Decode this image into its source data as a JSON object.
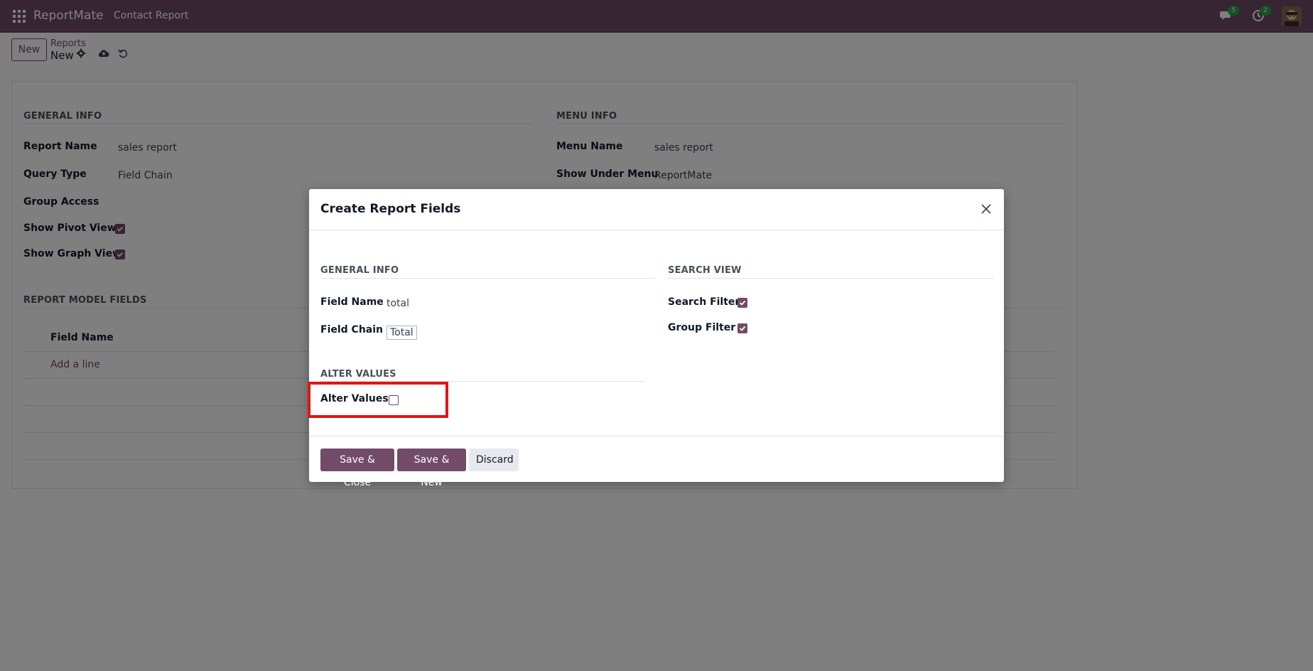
{
  "navbar": {
    "brand": "ReportMate",
    "menu_item": "Contact Report",
    "messages_badge": "5",
    "activities_badge": "2",
    "colors": {
      "bar": "#714b67",
      "badge": "#28a745"
    },
    "icons": [
      "apps-grid-icon",
      "chat-icon",
      "clock-icon",
      "avatar"
    ]
  },
  "control_panel": {
    "new_label": "New",
    "breadcrumb": "Reports",
    "record_title": "New",
    "icons": [
      "gear-icon",
      "cloud-upload-icon",
      "undo-icon"
    ]
  },
  "form": {
    "general_info": {
      "title": "GENERAL INFO",
      "report_name_label": "Report Name",
      "report_name_value": "sales report",
      "query_type_label": "Query Type",
      "query_type_value": "Field Chain",
      "group_access_label": "Group Access",
      "show_pivot_label": "Show Pivot View",
      "show_graph_label": "Show Graph View"
    },
    "menu_info": {
      "title": "MENU INFO",
      "menu_name_label": "Menu Name",
      "menu_name_value": "sales report",
      "show_under_label": "Show Under Menu",
      "show_under_value": "ReportMate"
    },
    "report_model_fields": {
      "title": "REPORT MODEL FIELDS",
      "column_field_name": "Field Name",
      "add_line": "Add a line"
    }
  },
  "dialog": {
    "title": "Create Report Fields",
    "general_info": {
      "title": "GENERAL INFO",
      "field_name_label": "Field Name",
      "field_name_value": "total",
      "field_chain_label": "Field Chain",
      "field_chain_value": "Total"
    },
    "search_view": {
      "title": "SEARCH VIEW",
      "search_filter_label": "Search Filter",
      "group_filter_label": "Group Filter"
    },
    "alter_values": {
      "title": "ALTER VALUES",
      "alter_values_label": "Alter Values"
    },
    "footer": {
      "save_close": "Save & Close",
      "save_new": "Save & New",
      "discard": "Discard"
    },
    "highlight_color": "#e21414"
  }
}
